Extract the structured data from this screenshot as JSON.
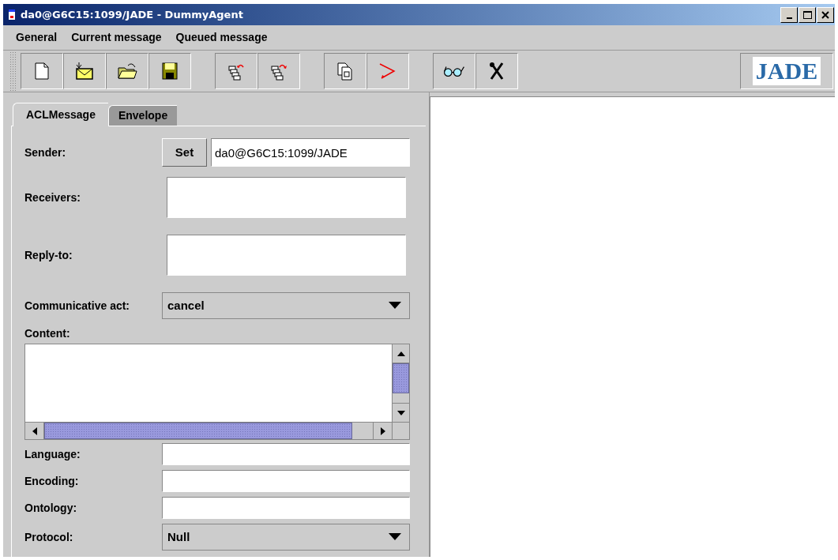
{
  "window": {
    "title": "da0@G6C15:1099/JADE - DummyAgent"
  },
  "menu": [
    "General",
    "Current message",
    "Queued message"
  ],
  "toolbar": {
    "logo": "JADE"
  },
  "tabs": [
    {
      "label": "ACLMessage",
      "selected": true
    },
    {
      "label": "Envelope",
      "selected": false
    }
  ],
  "fields": [
    {
      "kind": "set",
      "label": "Sender:",
      "button": "Set",
      "value": "da0@G6C15:1099/JADE"
    },
    {
      "kind": "list",
      "label": "Receivers:"
    },
    {
      "kind": "list",
      "label": "Reply-to:"
    },
    {
      "kind": "combo",
      "label": "Communicative act:",
      "value": "cancel"
    },
    {
      "kind": "area",
      "label": "Content:"
    },
    {
      "kind": "text",
      "label": "Language:"
    },
    {
      "kind": "text",
      "label": "Encoding:"
    },
    {
      "kind": "text",
      "label": "Ontology:"
    },
    {
      "kind": "combo",
      "label": "Protocol:",
      "value": "Null"
    }
  ]
}
